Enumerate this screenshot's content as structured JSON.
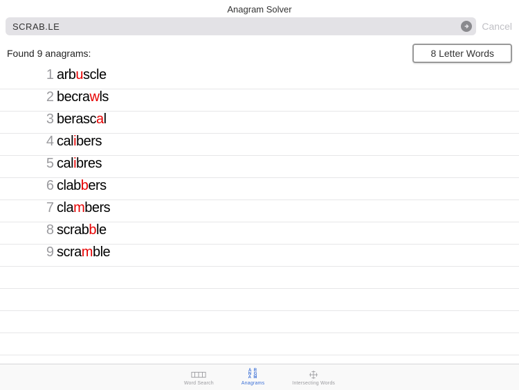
{
  "header": {
    "title": "Anagram Solver"
  },
  "search": {
    "value": "SCRAB.LE",
    "cancel": "Cancel"
  },
  "results": {
    "found_text": "Found 9 anagrams:",
    "filter_label": "8 Letter Words",
    "items": [
      {
        "n": "1",
        "parts": [
          {
            "t": "arb"
          },
          {
            "t": "u",
            "w": true
          },
          {
            "t": "scle"
          }
        ]
      },
      {
        "n": "2",
        "parts": [
          {
            "t": "becra"
          },
          {
            "t": "w",
            "w": true
          },
          {
            "t": "ls"
          }
        ]
      },
      {
        "n": "3",
        "parts": [
          {
            "t": "berasc"
          },
          {
            "t": "a",
            "w": true
          },
          {
            "t": "l"
          }
        ]
      },
      {
        "n": "4",
        "parts": [
          {
            "t": "cal"
          },
          {
            "t": "i",
            "w": true
          },
          {
            "t": "bers"
          }
        ]
      },
      {
        "n": "5",
        "parts": [
          {
            "t": "cal"
          },
          {
            "t": "i",
            "w": true
          },
          {
            "t": "bres"
          }
        ]
      },
      {
        "n": "6",
        "parts": [
          {
            "t": "clab"
          },
          {
            "t": "b",
            "w": true
          },
          {
            "t": "ers"
          }
        ]
      },
      {
        "n": "7",
        "parts": [
          {
            "t": "cla"
          },
          {
            "t": "m",
            "w": true
          },
          {
            "t": "bers"
          }
        ]
      },
      {
        "n": "8",
        "parts": [
          {
            "t": "scrab"
          },
          {
            "t": "b",
            "w": true
          },
          {
            "t": "le"
          }
        ]
      },
      {
        "n": "9",
        "parts": [
          {
            "t": "scra"
          },
          {
            "t": "m",
            "w": true
          },
          {
            "t": "ble"
          }
        ]
      }
    ],
    "empty_rows": 4
  },
  "tabs": {
    "word_search": "Word Search",
    "anagrams": "Anagrams",
    "intersecting": "Intersecting Words"
  }
}
